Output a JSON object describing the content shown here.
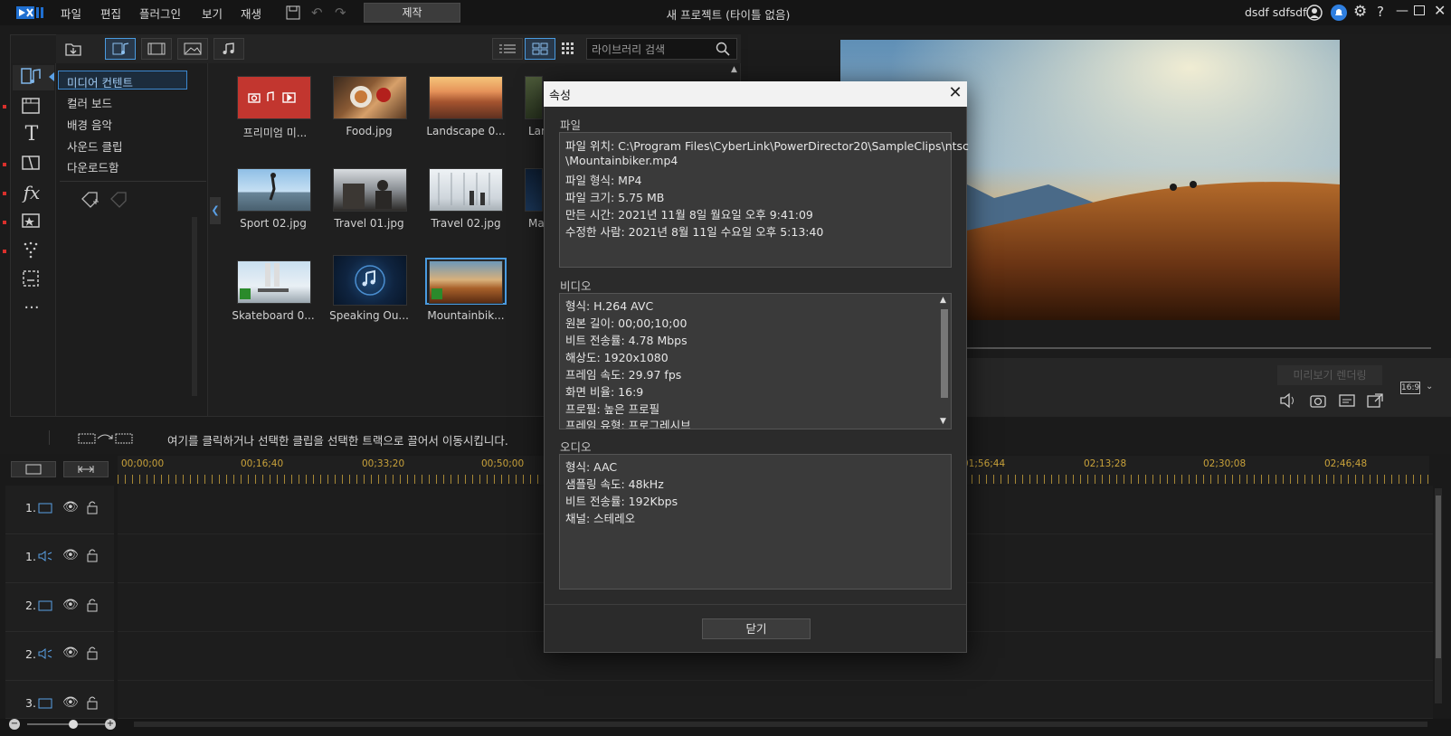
{
  "menu": {
    "items": [
      "파일",
      "편집",
      "플러그인",
      "보기",
      "재생"
    ],
    "produce": "제작",
    "window_title": "새 프로젝트 (타이틀 없음)",
    "username": "dsdf sdfsdf"
  },
  "library": {
    "search_placeholder": "라이브러리 검색",
    "tree": [
      "미디어 컨텐트",
      "컬러 보드",
      "배경 음악",
      "사운드 클립",
      "다운로드함"
    ],
    "thumbs_row1": [
      "프리미엄 미...",
      "Food.jpg",
      "Landscape 0...",
      "Lan"
    ],
    "thumbs_row2": [
      "Sport 02.jpg",
      "Travel 01.jpg",
      "Travel 02.jpg",
      "Ma"
    ],
    "thumbs_row3": [
      "Skateboard 0...",
      "Speaking Ou...",
      "Mountainbik..."
    ]
  },
  "preview": {
    "render_button": "미리보기 렌더링",
    "aspect": "16:9"
  },
  "timeline": {
    "hint": "여기를 클릭하거나 선택한 클립을 선택한 트랙으로 끌어서 이동시킵니다.",
    "ruler": [
      "00;00;00",
      "00;16;40",
      "00;33;20",
      "00;50;00",
      "01;56;44",
      "02;13;28",
      "02;30;08",
      "02;46;48"
    ],
    "tracks": [
      "1.",
      "1.",
      "2.",
      "2.",
      "3."
    ]
  },
  "dialog": {
    "title": "속성",
    "file_label": "파일",
    "file_lines": [
      "파일 위치: C:\\Program Files\\CyberLink\\PowerDirector20\\SampleClips\\ntsc",
      "\\Mountainbiker.mp4",
      "파일 형식: MP4",
      "파일 크기: 5.75 MB",
      "만든 시간: 2021년 11월 8일 월요일 오후 9:41:09",
      "수정한 사람: 2021년 8월 11일 수요일 오후 5:13:40"
    ],
    "video_label": "비디오",
    "video_lines": [
      "형식: H.264 AVC",
      "원본 길이: 00;00;10;00",
      "비트 전송률: 4.78 Mbps",
      "해상도: 1920x1080",
      "프레임 속도: 29.97 fps",
      "화면 비율: 16:9",
      "프로필: 높은 프로필",
      "프레임 유형: 프로그레시브"
    ],
    "audio_label": "오디오",
    "audio_lines": [
      "형식: AAC",
      "샘플링 속도: 48kHz",
      "비트 전송률: 192Kbps",
      "채널: 스테레오"
    ],
    "close_button": "닫기"
  },
  "colors": {
    "accent": "#3c88cf",
    "ruler": "#c9a23a",
    "red_dot": "#d9302c"
  }
}
